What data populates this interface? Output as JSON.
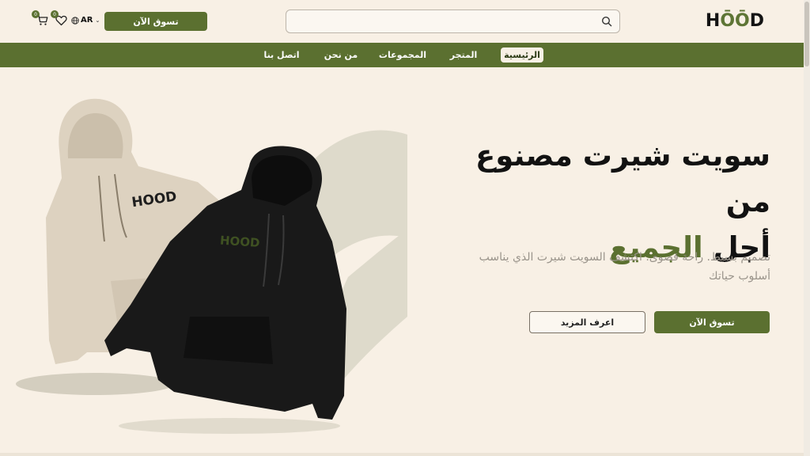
{
  "header": {
    "logo": {
      "prefix": "H",
      "oo": "ŌŌ",
      "suffix": "D"
    },
    "search": {
      "placeholder": ""
    },
    "shop_button": "تسوق الآن",
    "language": "AR",
    "wishlist_count": "0",
    "cart_count": "0"
  },
  "nav": {
    "items": [
      {
        "label": "الرئيسية",
        "active": true
      },
      {
        "label": "المتجر"
      },
      {
        "label": "المجموعات"
      },
      {
        "label": "من نحن"
      },
      {
        "label": "اتصل بنا"
      }
    ]
  },
  "hero": {
    "title_line1": "سويت شيرت مصنوع من",
    "title_line2_plain": "أجل",
    "title_line2_accent": "الجميع",
    "description": "تصميم بسيط. راحة قصوى. اكتشف السويت شيرت الذي يناسب أسلوب حياتك",
    "primary_button": "تسوق الآن",
    "secondary_button": "اعرف المزيد",
    "hoodie_logo": "HOOD"
  },
  "colors": {
    "brand": "#5b7030",
    "background": "#f8f0e5"
  }
}
